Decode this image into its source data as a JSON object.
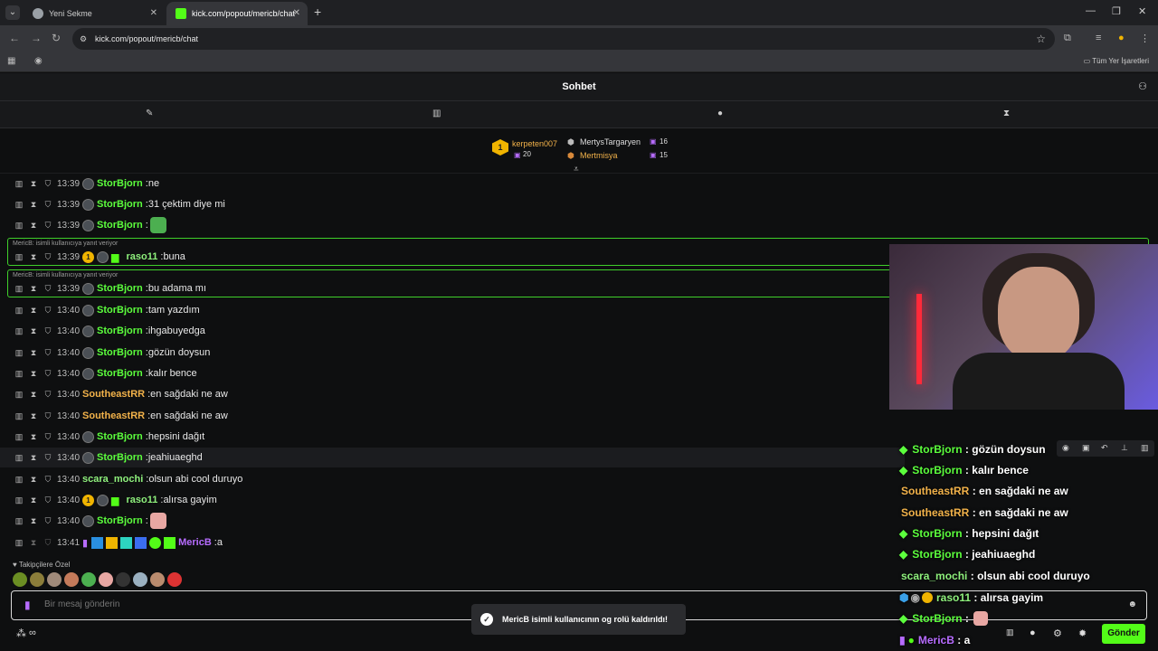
{
  "browser": {
    "tabs": [
      {
        "title": "Yeni Sekme"
      },
      {
        "title": "kick.com/popout/mericb/chat"
      }
    ],
    "url": "kick.com/popout/mericb/chat",
    "bookmarks_label": "Tüm Yer İşaretleri"
  },
  "header": {
    "title": "Sohbet"
  },
  "gifters": {
    "top": {
      "rank": "1",
      "name": "kerpeten007",
      "count": "20"
    },
    "second": {
      "name": "MertysTargaryen",
      "count": "16"
    },
    "third": {
      "name": "Mertmisya",
      "count": "15"
    }
  },
  "chat": {
    "messages": [
      {
        "time": "13:39",
        "user": "StorBjorn",
        "text": "ne"
      },
      {
        "time": "13:39",
        "user": "StorBjorn",
        "text": "31 çektim diye mi"
      },
      {
        "time": "13:39",
        "user": "StorBjorn",
        "text": ""
      },
      {
        "time": "13:39",
        "user": "raso11",
        "text": "buna",
        "reply": "MericB: isimli kullanıcıya yanıt veriyor"
      },
      {
        "time": "13:39",
        "user": "StorBjorn",
        "text": "bu adama mı",
        "reply": "MericB: isimli kullanıcıya yanıt veriyor"
      },
      {
        "time": "13:40",
        "user": "StorBjorn",
        "text": "tam yazdım"
      },
      {
        "time": "13:40",
        "user": "StorBjorn",
        "text": "ihgabuyedga"
      },
      {
        "time": "13:40",
        "user": "StorBjorn",
        "text": "gözün doysun"
      },
      {
        "time": "13:40",
        "user": "StorBjorn",
        "text": "kalır bence"
      },
      {
        "time": "13:40",
        "user": "SoutheastRR",
        "text": "en sağdaki ne aw"
      },
      {
        "time": "13:40",
        "user": "SoutheastRR",
        "text": "en sağdaki ne aw"
      },
      {
        "time": "13:40",
        "user": "StorBjorn",
        "text": "hepsini dağıt"
      },
      {
        "time": "13:40",
        "user": "StorBjorn",
        "text": "jeahiuaeghd"
      },
      {
        "time": "13:40",
        "user": "scara_mochi",
        "text": "olsun abi cool duruyo"
      },
      {
        "time": "13:40",
        "user": "raso11",
        "text": "alırsa gayim"
      },
      {
        "time": "13:40",
        "user": "StorBjorn",
        "text": ""
      },
      {
        "time": "13:41",
        "user": "MericB",
        "text": "a"
      }
    ],
    "followers_label": "Takipçilere Özel",
    "input_placeholder": "Bir mesaj gönderin",
    "send_label": "Gönder",
    "toast": "MericB isimli kullanıcının og rolü kaldırıldı!"
  },
  "overlay": {
    "messages": [
      {
        "user": "StorBjorn",
        "text": "gözün doysun"
      },
      {
        "user": "StorBjorn",
        "text": "kalır bence"
      },
      {
        "user": "SoutheastRR",
        "text": "en sağdaki ne aw"
      },
      {
        "user": "SoutheastRR",
        "text": "en sağdaki ne aw"
      },
      {
        "user": "StorBjorn",
        "text": "hepsini dağıt"
      },
      {
        "user": "StorBjorn",
        "text": "jeahiuaeghd"
      },
      {
        "user": "scara_mochi",
        "text": "olsun abi cool duruyo"
      },
      {
        "user": "raso11",
        "text": "alırsa gayim"
      },
      {
        "user": "StorBjorn",
        "text": ""
      },
      {
        "user": "MericB",
        "text": "a"
      }
    ],
    "separator": ":"
  },
  "colors": {
    "accent": "#53fc18",
    "username_green": "#5cff3d",
    "username_orange": "#f2b24a",
    "username_purple": "#b76cff"
  }
}
